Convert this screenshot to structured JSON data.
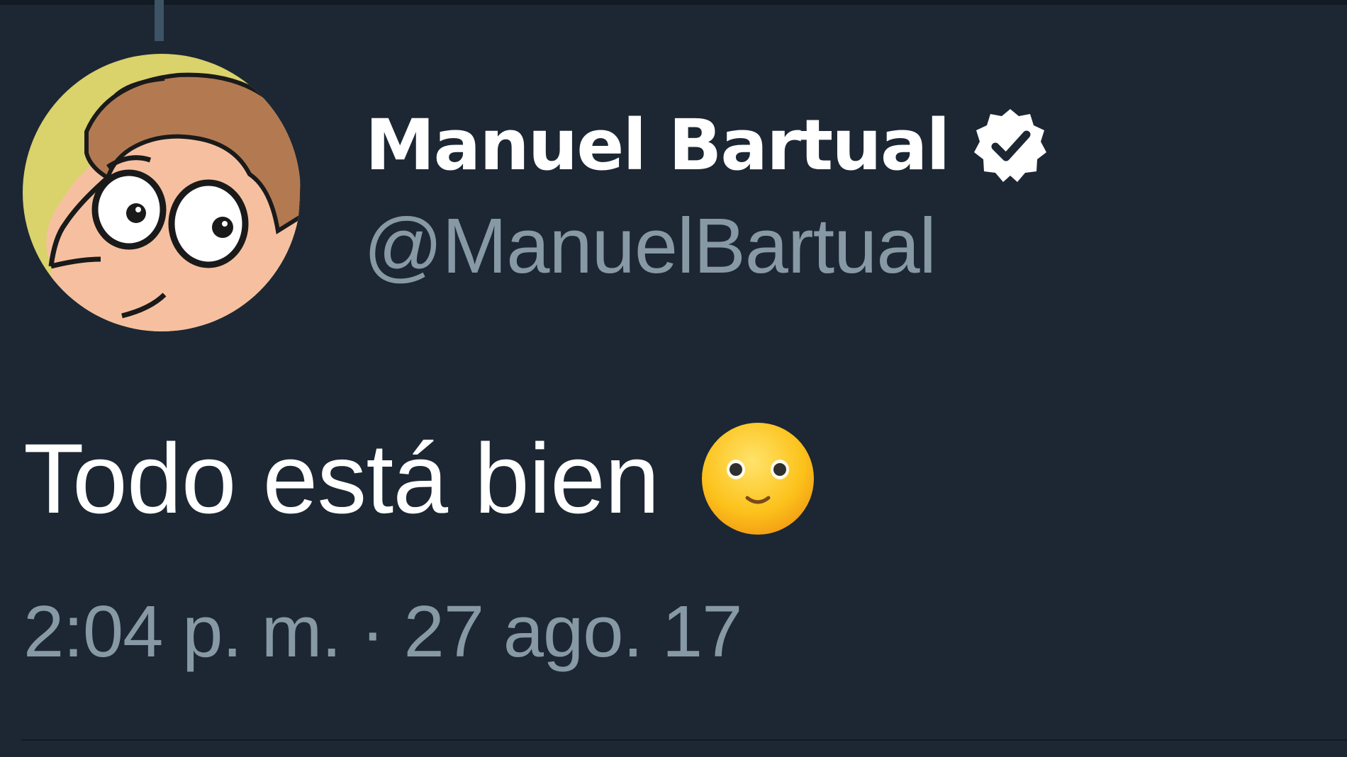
{
  "tweet": {
    "author": {
      "display_name": "Manuel Bartual",
      "handle": "@ManuelBartual",
      "verified": true,
      "avatar_icon": "cartoon-face-avatar"
    },
    "text": "Todo está bien",
    "emoji_icon": "slightly-smiling-face-icon",
    "timestamp": "2:04 p. m. · 27 ago. 17"
  },
  "colors": {
    "background": "#1c2733",
    "name": "#ffffff",
    "secondary_text": "#8899a6",
    "thread_line": "#3d5466"
  }
}
